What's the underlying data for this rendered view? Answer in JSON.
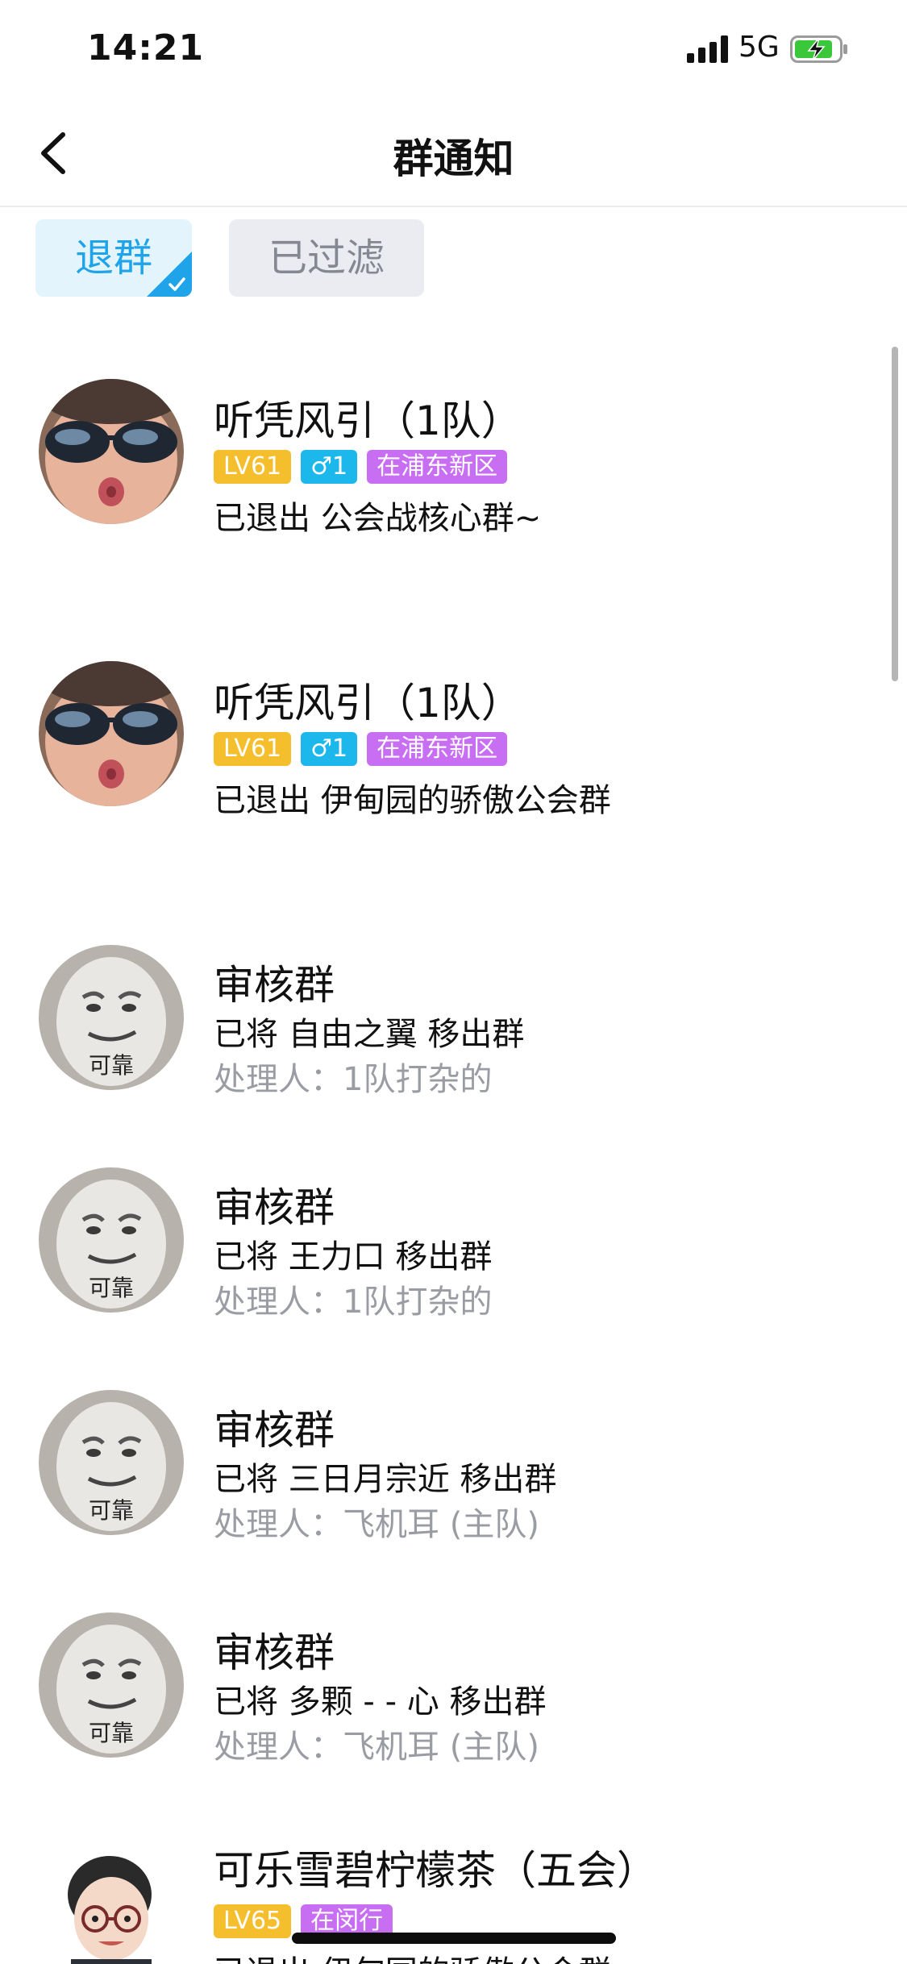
{
  "status_bar": {
    "time": "14:21",
    "network": "5G"
  },
  "nav": {
    "title": "群通知"
  },
  "tabs": [
    {
      "label": "退群",
      "selected": true
    },
    {
      "label": "已过滤",
      "selected": false
    }
  ],
  "colors": {
    "accent": "#1fa4ea",
    "badge_level": "#f5be2c",
    "badge_gender": "#1cb8ec",
    "badge_location": "#c76ef3",
    "secondary_text": "#9a9ca4"
  },
  "notifications": [
    {
      "avatar": "sunglasses-kid-avatar",
      "name": "听凭风引（1队）",
      "badges": {
        "level": "LV61",
        "gender": "♂1",
        "location": "在浦东新区"
      },
      "action": "已退出 公会战核心群~"
    },
    {
      "avatar": "sunglasses-kid-avatar",
      "name": "听凭风引（1队）",
      "badges": {
        "level": "LV61",
        "gender": "♂1",
        "location": "在浦东新区"
      },
      "action": "已退出 伊甸园的骄傲公会群"
    },
    {
      "avatar": "reliable-meme-avatar",
      "avatar_text": "可靠",
      "name": "审核群",
      "action": "已将 自由之翼 移出群",
      "handler": "处理人：1队打杂的"
    },
    {
      "avatar": "reliable-meme-avatar",
      "avatar_text": "可靠",
      "name": "审核群",
      "action": "已将 王力口 移出群",
      "handler": "处理人：1队打杂的"
    },
    {
      "avatar": "reliable-meme-avatar",
      "avatar_text": "可靠",
      "name": "审核群",
      "action": "已将 三日月宗近 移出群",
      "handler": "处理人：飞机耳 (主队)"
    },
    {
      "avatar": "reliable-meme-avatar",
      "avatar_text": "可靠",
      "name": "审核群",
      "action": "已将 多颗 - - 心 移出群",
      "handler": "处理人：飞机耳 (主队)"
    },
    {
      "avatar": "cartoon-man-avatar",
      "name": "可乐雪碧柠檬茶（五会）",
      "badges": {
        "level": "LV65",
        "location": "在闵行"
      },
      "action": "已退出 伊甸园的骄傲公会群"
    }
  ]
}
